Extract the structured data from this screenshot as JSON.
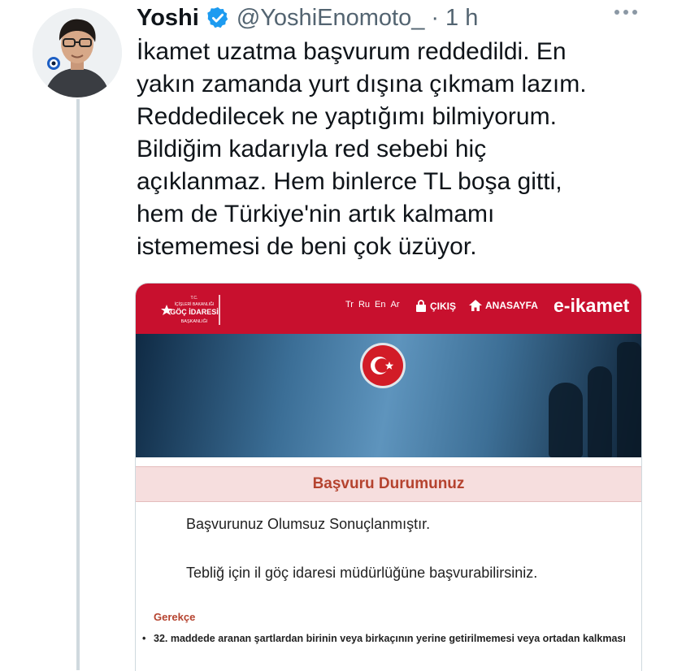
{
  "tweet": {
    "author_name": "Yoshi",
    "handle": "@YoshiEnomoto_",
    "separator": "·",
    "time": "1 h",
    "text_lines": [
      "İkamet uzatma başvurum reddedildi. En",
      "yakın zamanda yurt dışına çıkmam lazım.",
      "Reddedilecek ne yaptığımı bilmiyorum.",
      "Bildiğim kadarıyla red sebebi hiç",
      "açıklanmaz. Hem binlerce TL boşa gitti,",
      "hem de Türkiye'nin artık kalmamı",
      "istememesi de beni çok üzüyor."
    ]
  },
  "card": {
    "logo_lines": [
      "T.C.",
      "İÇİŞLERİ BAKANLIĞI",
      "GÖÇ İDARESİ",
      "BAŞKANLIĞI"
    ],
    "languages": [
      "Tr",
      "Ru",
      "En",
      "Ar"
    ],
    "logout_label": "ÇIKIŞ",
    "home_label": "ANASAYFA",
    "brand": "e-ikamet",
    "status_title": "Başvuru Durumunuz",
    "status_result": "Başvurunuz Olumsuz Sonuçlanmıştır.",
    "status_instruction": "Tebliğ için il göç idaresi müdürlüğüne başvurabilirsiniz.",
    "reason_heading": "Gerekçe",
    "reason_text": "32. maddede aranan şartlardan birinin veya birkaçının yerine getirilmemesi veya ortadan kalkması"
  },
  "colors": {
    "accent_red": "#c8102e",
    "verified_blue": "#1d9bf0",
    "status_text": "#b5432f"
  },
  "icons": [
    "verified-badge-icon",
    "more-options-icon",
    "lock-icon",
    "home-icon",
    "turkish-flag-icon"
  ]
}
